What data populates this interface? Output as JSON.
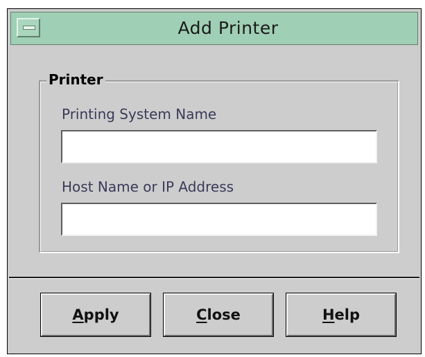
{
  "window": {
    "title": "Add Printer"
  },
  "group": {
    "label": "Printer"
  },
  "fields": [
    {
      "label": "Printing System Name",
      "value": ""
    },
    {
      "label": "Host Name or IP Address",
      "value": ""
    }
  ],
  "buttons": [
    {
      "label": "Apply",
      "mnemonic": "A",
      "rest": "pply"
    },
    {
      "label": "Close",
      "mnemonic": "C",
      "rest": "lose"
    },
    {
      "label": "Help",
      "mnemonic": "H",
      "rest": "elp"
    }
  ],
  "colors": {
    "titlebar": "#9fcfb4",
    "window_bg": "#cdcdcd"
  },
  "icons": {
    "window_menu": "window-menu-icon"
  }
}
